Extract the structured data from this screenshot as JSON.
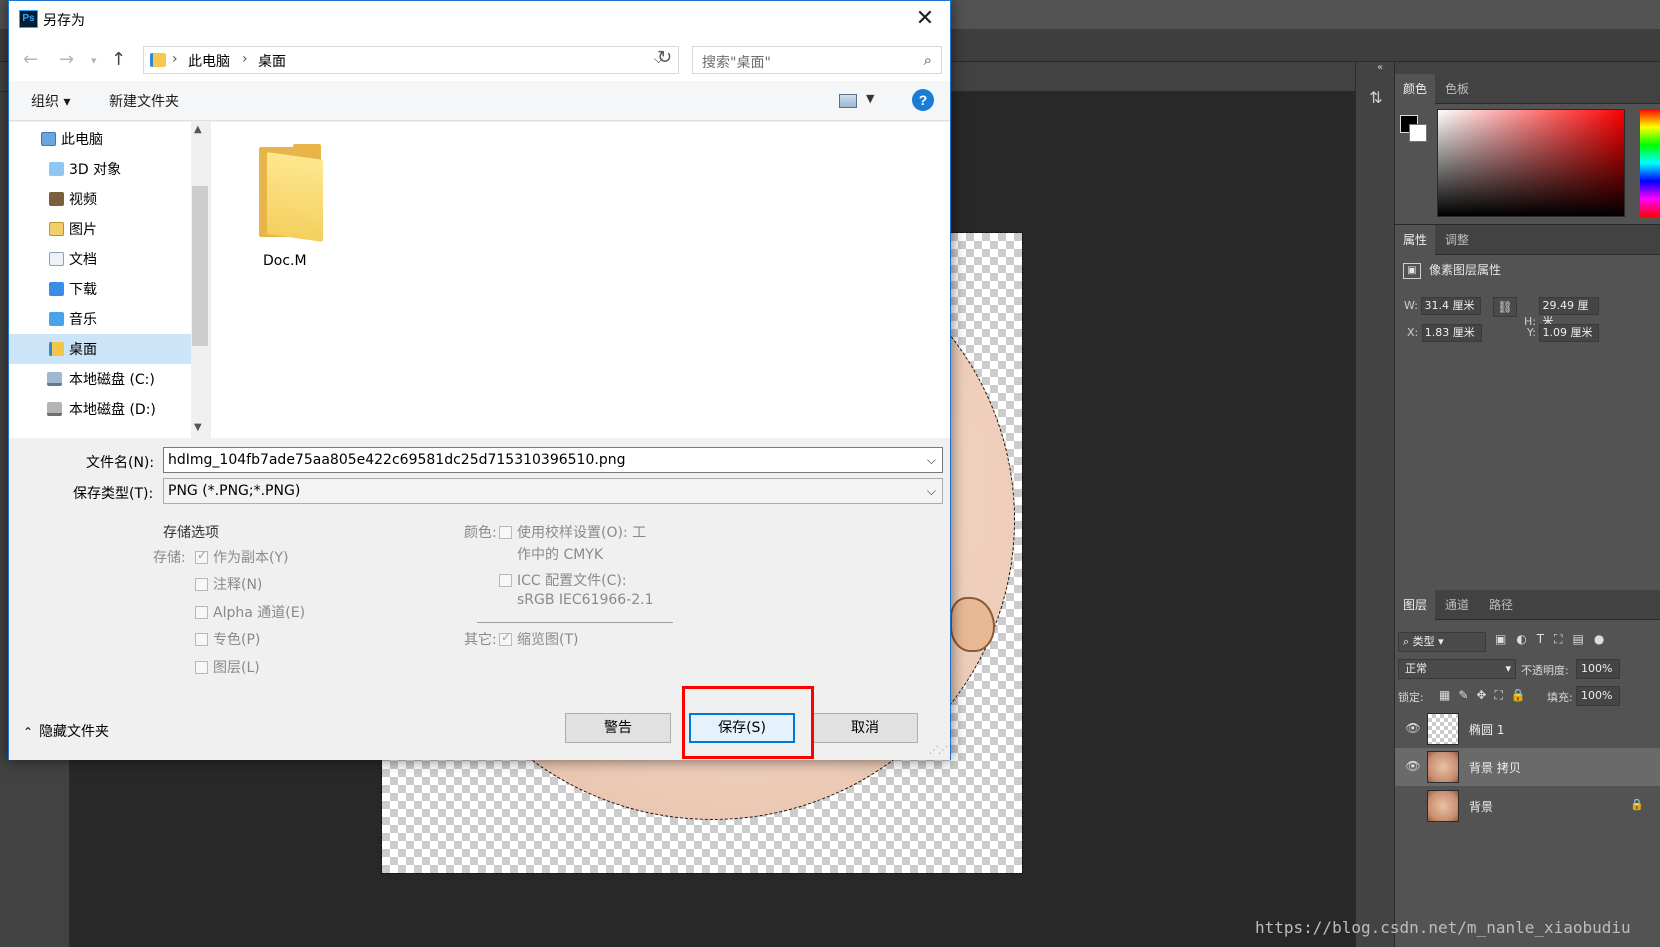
{
  "photoshop": {
    "color_panel": {
      "tabs": [
        "颜色",
        "色板"
      ]
    },
    "properties_panel": {
      "tabs": [
        "属性",
        "调整"
      ],
      "heading": "像素图层属性",
      "w_label": "W:",
      "w_value": "31.4 厘米",
      "h_label": "H:",
      "h_value": "29.49 厘米",
      "x_label": "X:",
      "x_value": "1.83 厘米",
      "y_label": "Y:",
      "y_value": "1.09 厘米"
    },
    "layers_panel": {
      "tabs": [
        "图层",
        "通道",
        "路径"
      ],
      "filter_value": "类型",
      "blend_mode": "正常",
      "opacity_label": "不透明度:",
      "opacity_value": "100%",
      "lock_label": "锁定:",
      "fill_label": "填充:",
      "fill_value": "100%",
      "layers": [
        {
          "name": "椭圆 1",
          "visible": true,
          "selected": false
        },
        {
          "name": "背景 拷贝",
          "visible": true,
          "selected": true
        },
        {
          "name": "背景",
          "visible": false,
          "selected": false,
          "locked": true
        }
      ]
    },
    "watermark": "https://blog.csdn.net/m_nanle_xiaobudiu"
  },
  "dialog": {
    "title": "另存为",
    "address": {
      "parts": [
        "此电脑",
        "桌面"
      ]
    },
    "search_placeholder": "搜索\"桌面\"",
    "toolbar": {
      "organize": "组织 ▾",
      "new_folder": "新建文件夹"
    },
    "tree": [
      {
        "label": "此电脑",
        "icon": "pc-icon",
        "indent": 1
      },
      {
        "label": "3D 对象",
        "icon": "3d-objects-icon",
        "indent": 2
      },
      {
        "label": "视频",
        "icon": "video-icon",
        "indent": 2
      },
      {
        "label": "图片",
        "icon": "pictures-icon",
        "indent": 2
      },
      {
        "label": "文档",
        "icon": "documents-icon",
        "indent": 2
      },
      {
        "label": "下载",
        "icon": "downloads-icon",
        "indent": 2
      },
      {
        "label": "音乐",
        "icon": "music-icon",
        "indent": 2
      },
      {
        "label": "桌面",
        "icon": "desktop-icon",
        "indent": 2,
        "selected": true
      },
      {
        "label": "本地磁盘 (C:)",
        "icon": "drive-c-icon",
        "indent": 2
      },
      {
        "label": "本地磁盘 (D:)",
        "icon": "drive-d-icon",
        "indent": 2
      }
    ],
    "files": [
      {
        "name": "Doc.M",
        "icon": "folder-icon"
      }
    ],
    "filename_label": "文件名(N):",
    "filename_value": "hdImg_104fb7ade75aa805e422c69581dc25d715310396510.png",
    "filetype_label": "保存类型(T):",
    "filetype_value": "PNG (*.PNG;*.PNG)",
    "options": {
      "heading": "存储选项",
      "save_label": "存储:",
      "as_copy": "作为副本(Y)",
      "notes": "注释(N)",
      "alpha": "Alpha 通道(E)",
      "spot": "专色(P)",
      "layers": "图层(L)",
      "color_label": "颜色:",
      "proof_line1": "使用校样设置(O): 工",
      "proof_line2": "作中的 CMYK",
      "icc_line1": "ICC 配置文件(C):",
      "icc_line2": "sRGB IEC61966-2.1",
      "other_label": "其它:",
      "thumbnail": "缩览图(T)"
    },
    "hide_folders": "隐藏文件夹",
    "buttons": {
      "warning": "警告",
      "save": "保存(S)",
      "cancel": "取消"
    },
    "highlight_color": "#ff0000",
    "accent_color": "#0078d7"
  }
}
